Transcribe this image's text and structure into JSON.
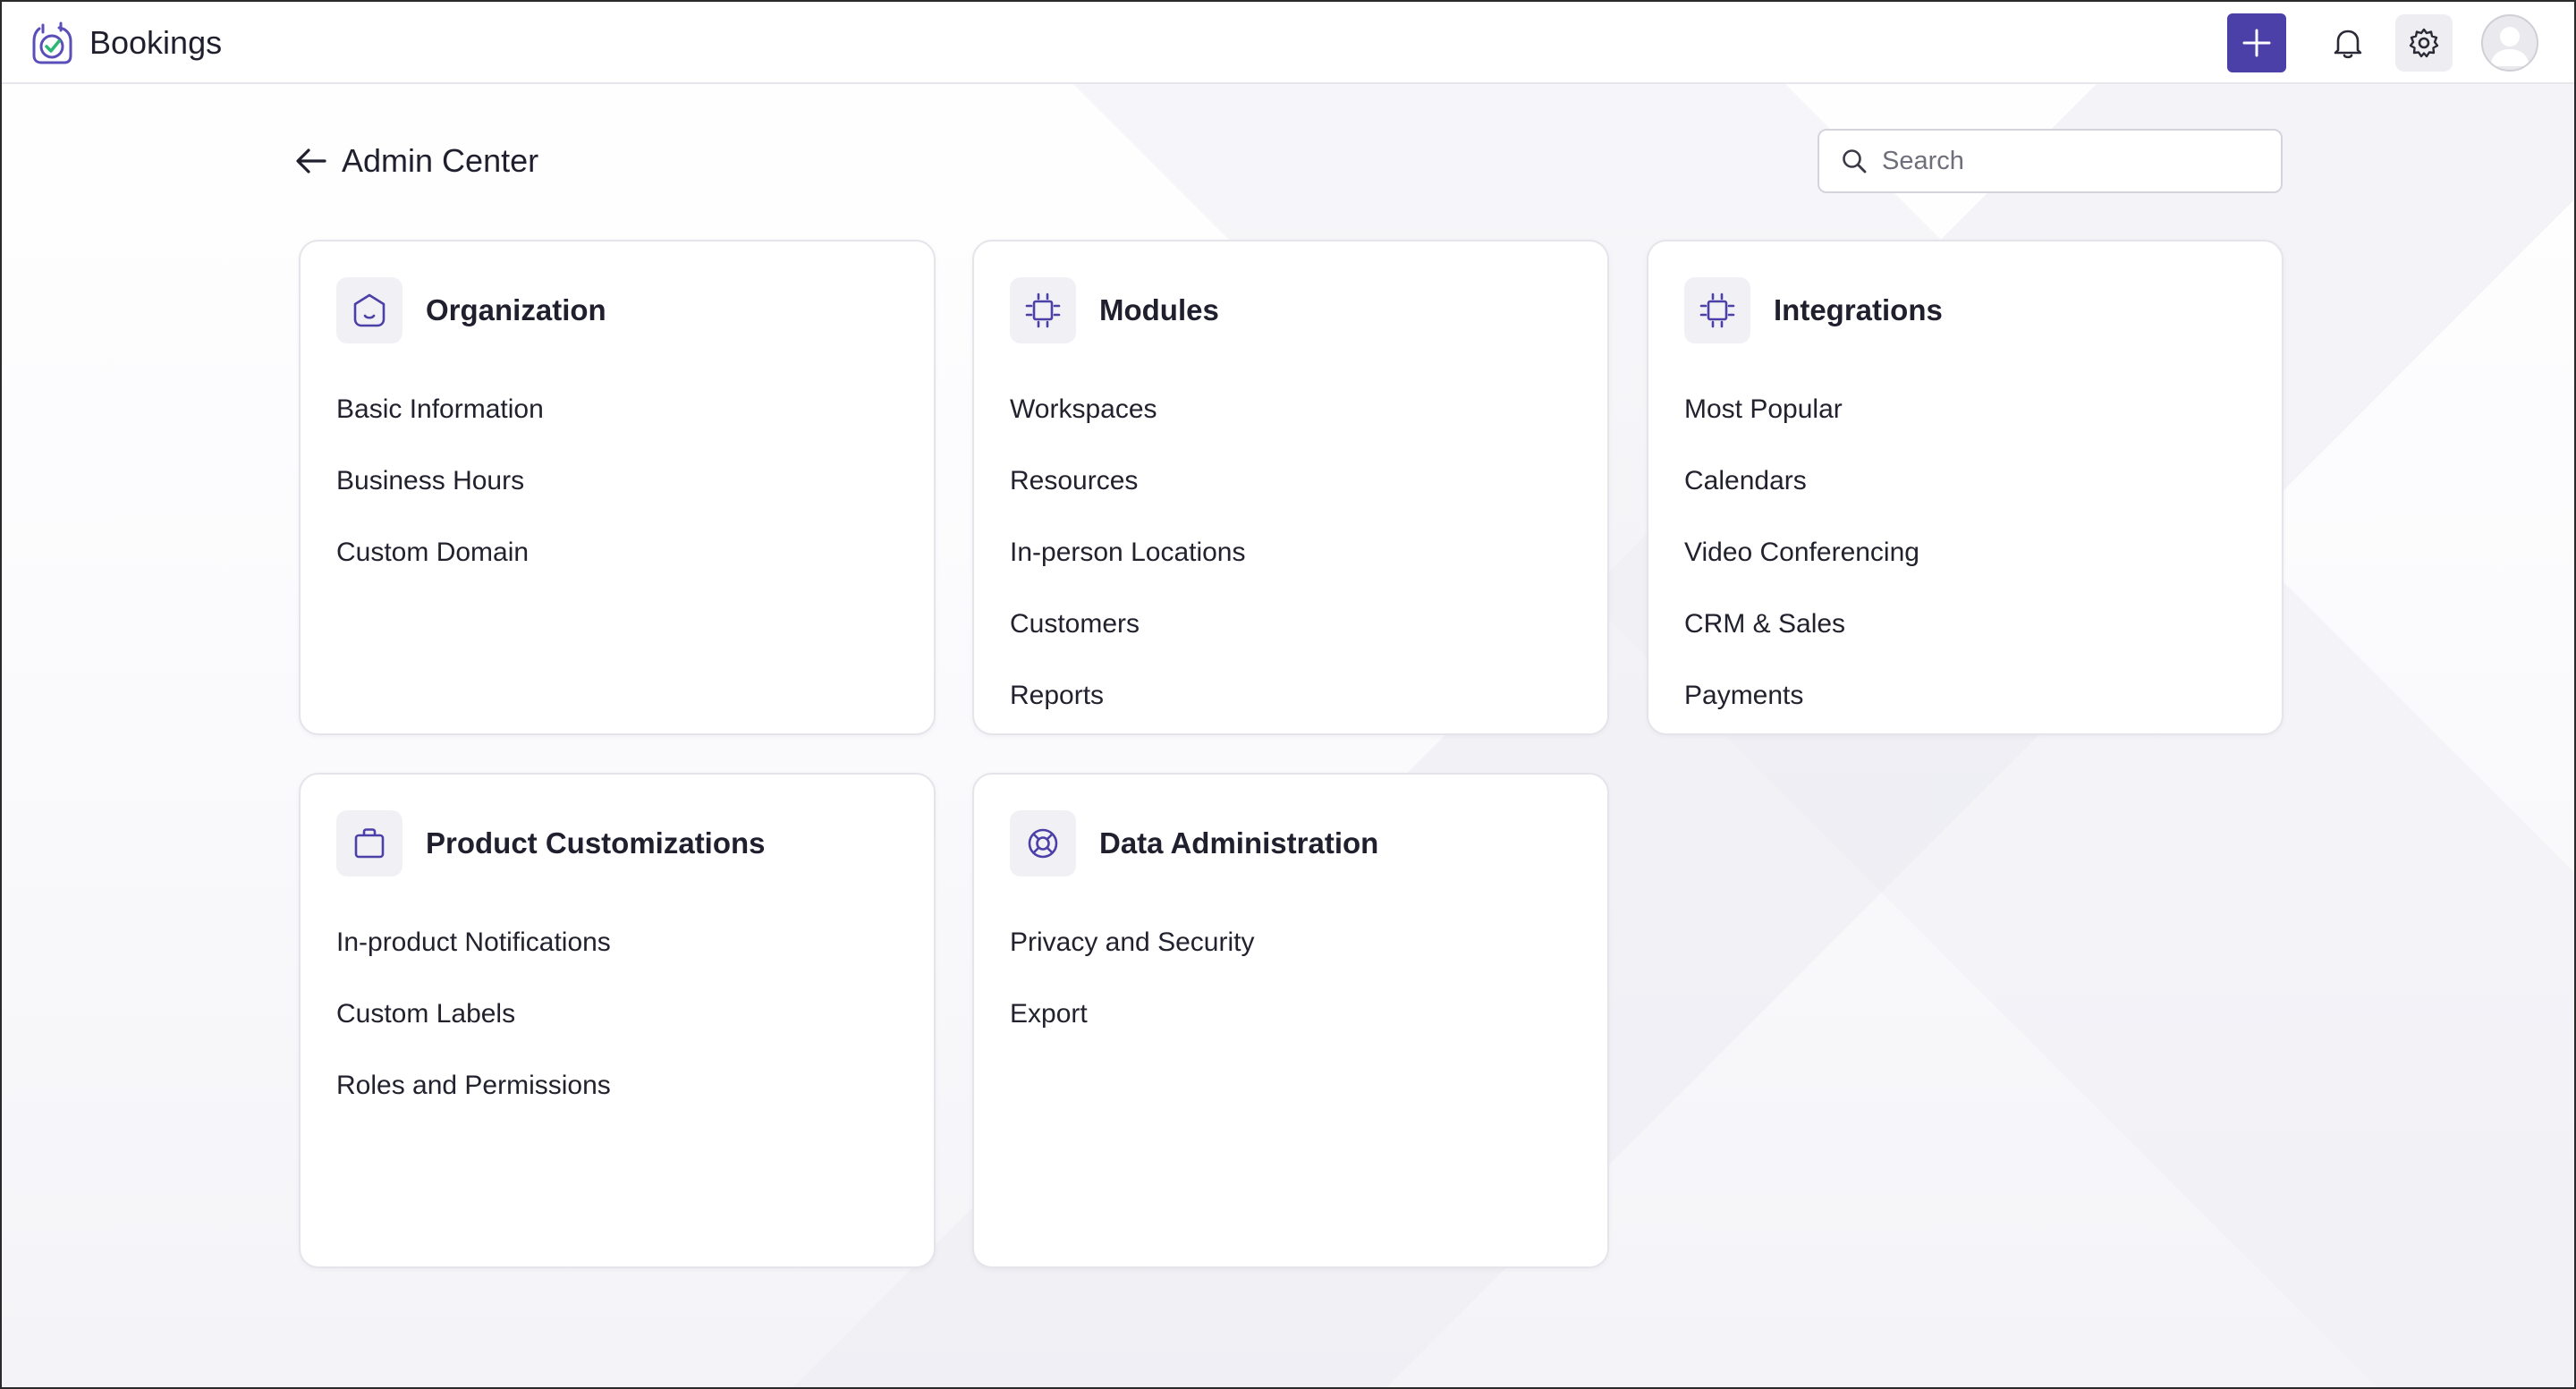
{
  "app": {
    "name": "Bookings"
  },
  "topbar": {
    "add_icon": "plus-icon",
    "notifications_icon": "bell-icon",
    "settings_icon": "gear-icon",
    "avatar_icon": "user-avatar-icon",
    "accent_color": "#4b3fa8"
  },
  "page": {
    "title": "Admin Center",
    "back_icon": "arrow-left-icon"
  },
  "search": {
    "placeholder": "Search",
    "value": ""
  },
  "cards": [
    {
      "title": "Organization",
      "icon": "organization-icon",
      "items": [
        "Basic Information",
        "Business Hours",
        "Custom Domain"
      ]
    },
    {
      "title": "Modules",
      "icon": "modules-chip-icon",
      "items": [
        "Workspaces",
        "Resources",
        "In-person Locations",
        "Customers",
        "Reports"
      ]
    },
    {
      "title": "Integrations",
      "icon": "integrations-chip-icon",
      "items": [
        "Most Popular",
        "Calendars",
        "Video Conferencing",
        "CRM & Sales",
        "Payments"
      ]
    },
    {
      "title": "Product Customizations",
      "icon": "briefcase-icon",
      "items": [
        "In-product Notifications",
        "Custom Labels",
        "Roles and Permissions"
      ]
    },
    {
      "title": "Data Administration",
      "icon": "lifebuoy-icon",
      "items": [
        "Privacy and Security",
        "Export"
      ]
    }
  ]
}
